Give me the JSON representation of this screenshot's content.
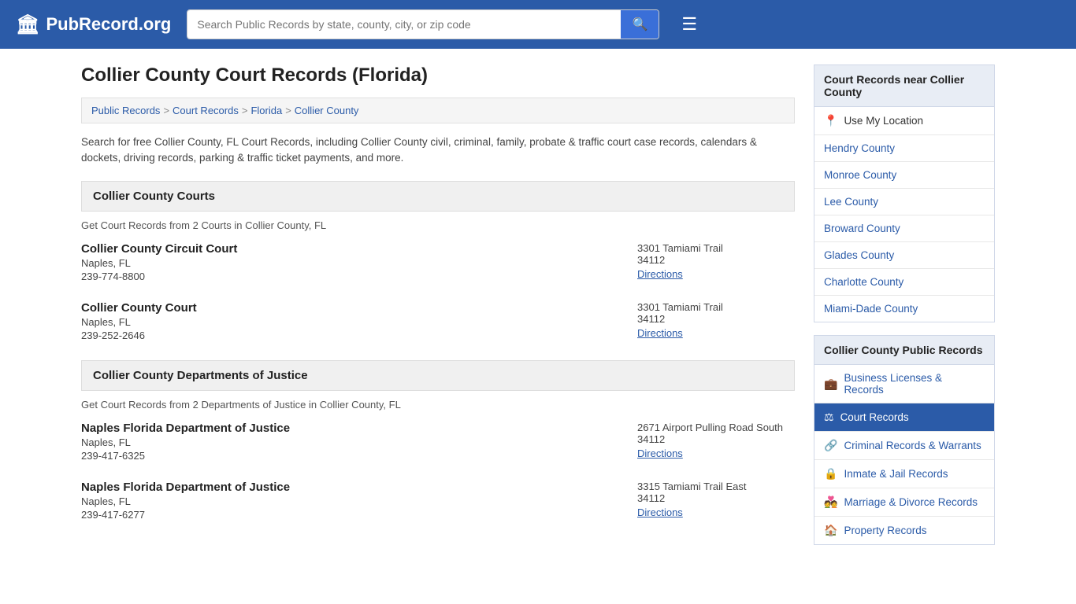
{
  "header": {
    "logo_icon": "🏛",
    "logo_text": "PubRecord.org",
    "search_placeholder": "Search Public Records by state, county, city, or zip code",
    "search_button_icon": "🔍",
    "menu_icon": "☰"
  },
  "page": {
    "title": "Collier County Court Records (Florida)",
    "breadcrumbs": [
      {
        "label": "Public Records",
        "href": "#"
      },
      {
        "label": "Court Records",
        "href": "#"
      },
      {
        "label": "Florida",
        "href": "#"
      },
      {
        "label": "Collier County",
        "href": "#"
      }
    ],
    "description": "Search for free Collier County, FL Court Records, including Collier County civil, criminal, family, probate & traffic court case records, calendars & dockets, driving records, parking & traffic ticket payments, and more."
  },
  "courts_section": {
    "header": "Collier County Courts",
    "description": "Get Court Records from 2 Courts in Collier County, FL",
    "courts": [
      {
        "name": "Collier County Circuit Court",
        "city": "Naples, FL",
        "phone": "239-774-8800",
        "address": "3301 Tamiami Trail",
        "zip": "34112",
        "directions_label": "Directions"
      },
      {
        "name": "Collier County Court",
        "city": "Naples, FL",
        "phone": "239-252-2646",
        "address": "3301 Tamiami Trail",
        "zip": "34112",
        "directions_label": "Directions"
      }
    ]
  },
  "doj_section": {
    "header": "Collier County Departments of Justice",
    "description": "Get Court Records from 2 Departments of Justice in Collier County, FL",
    "departments": [
      {
        "name": "Naples Florida Department of Justice",
        "city": "Naples, FL",
        "phone": "239-417-6325",
        "address": "2671 Airport Pulling Road South",
        "zip": "34112",
        "directions_label": "Directions"
      },
      {
        "name": "Naples Florida Department of Justice",
        "city": "Naples, FL",
        "phone": "239-417-6277",
        "address": "3315 Tamiami Trail East",
        "zip": "34112",
        "directions_label": "Directions"
      }
    ]
  },
  "sidebar": {
    "nearby_section": {
      "title": "Court Records near Collier County",
      "use_my_location": "Use My Location",
      "counties": [
        "Hendry County",
        "Monroe County",
        "Lee County",
        "Broward County",
        "Glades County",
        "Charlotte County",
        "Miami-Dade County"
      ]
    },
    "public_records_section": {
      "title": "Collier County Public Records",
      "items": [
        {
          "label": "Business Licenses & Records",
          "icon": "💼",
          "active": false
        },
        {
          "label": "Court Records",
          "icon": "⚖",
          "active": true
        },
        {
          "label": "Criminal Records & Warrants",
          "icon": "🔗",
          "active": false
        },
        {
          "label": "Inmate & Jail Records",
          "icon": "🔒",
          "active": false
        },
        {
          "label": "Marriage & Divorce Records",
          "icon": "💑",
          "active": false
        },
        {
          "label": "Property Records",
          "icon": "🏠",
          "active": false
        }
      ]
    }
  }
}
